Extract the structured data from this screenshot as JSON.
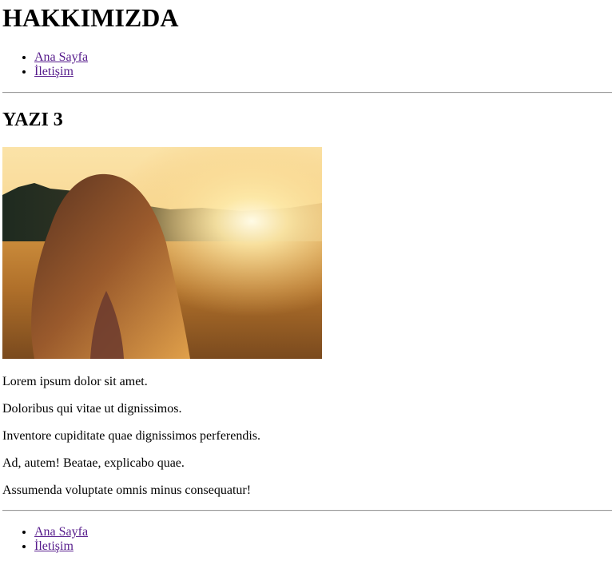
{
  "header": {
    "title": "HAKKIMIZDA",
    "nav": [
      "Ana Sayfa",
      "İletişim"
    ]
  },
  "article": {
    "title": "YAZI 3",
    "image": "sunset-field-photo",
    "paragraphs": [
      "Lorem ipsum dolor sit amet.",
      "Doloribus qui vitae ut dignissimos.",
      "Inventore cupiditate quae dignissimos perferendis.",
      "Ad, autem! Beatae, explicabo quae.",
      "Assumenda voluptate omnis minus consequatur!"
    ]
  },
  "footer": {
    "nav": [
      "Ana Sayfa",
      "İletişim"
    ]
  },
  "colors": {
    "link_visited": "#551a8b",
    "divider": "#9a9a9a"
  }
}
